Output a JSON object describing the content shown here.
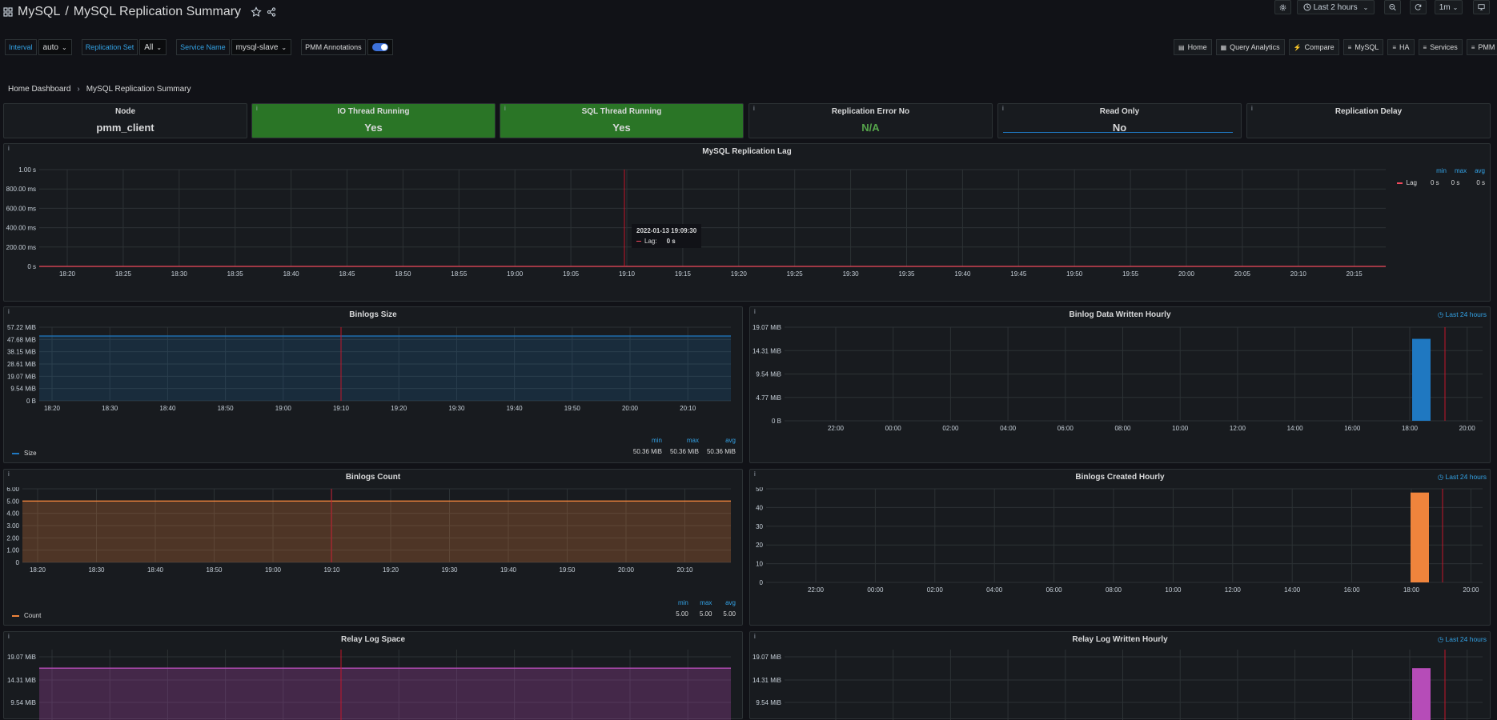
{
  "header": {
    "breadcrumb_folder": "MySQL",
    "breadcrumb_sep": "/",
    "dashboard_title": "MySQL Replication Summary",
    "time_range": "Last 2 hours",
    "refresh_interval": "1m"
  },
  "variables": {
    "interval_label": "Interval",
    "interval_value": "auto",
    "replication_set_label": "Replication Set",
    "replication_set_value": "All",
    "service_name_label": "Service Name",
    "service_name_value": "mysql-slave",
    "annotations_label": "PMM Annotations"
  },
  "links": [
    "Home",
    "Query Analytics",
    "Compare",
    "MySQL",
    "HA",
    "Services",
    "PMM"
  ],
  "breadcrumb": {
    "home": "Home Dashboard",
    "current": "MySQL Replication Summary"
  },
  "stats": [
    {
      "title": "Node",
      "value": "pmm_client"
    },
    {
      "title": "IO Thread Running",
      "value": "Yes"
    },
    {
      "title": "SQL Thread Running",
      "value": "Yes"
    },
    {
      "title": "Replication Error No",
      "value": "N/A"
    },
    {
      "title": "Read Only",
      "value": "No"
    },
    {
      "title": "Replication Delay",
      "value": ""
    }
  ],
  "colors": {
    "green_stat": "#2a7526",
    "lag": "#f2495c",
    "size": "#1f78c1",
    "count": "#ef843c",
    "relay": "#b64cb8",
    "link": "#33a2e5"
  },
  "legend_headers": {
    "min": "min",
    "max": "max",
    "avg": "avg"
  },
  "last24_label": "Last 24 hours",
  "tooltip": {
    "time": "2022-01-13 19:09:30",
    "series": "Lag:",
    "value": "0 s"
  },
  "panels": {
    "lag": {
      "title": "MySQL Replication Lag",
      "legend_name": "Lag",
      "min": "0 s",
      "max": "0 s",
      "avg": "0 s"
    },
    "binlogs_size": {
      "title": "Binlogs Size",
      "legend_name": "Size",
      "min": "50.36 MiB",
      "max": "50.36 MiB",
      "avg": "50.36 MiB"
    },
    "binlog_written": {
      "title": "Binlog Data Written Hourly"
    },
    "binlogs_count": {
      "title": "Binlogs Count",
      "legend_name": "Count",
      "min": "5.00",
      "max": "5.00",
      "avg": "5.00"
    },
    "binlogs_created": {
      "title": "Binlogs Created Hourly"
    },
    "relay_space": {
      "title": "Relay Log Space"
    },
    "relay_written": {
      "title": "Relay Log Written Hourly"
    }
  },
  "chart_data": [
    {
      "type": "line",
      "title": "MySQL Replication Lag",
      "series": [
        {
          "name": "Lag",
          "values": [
            0,
            0
          ]
        }
      ],
      "x": [
        "18:20",
        "20:15"
      ],
      "xticks": [
        "18:20",
        "18:25",
        "18:30",
        "18:35",
        "18:40",
        "18:45",
        "18:50",
        "18:55",
        "19:00",
        "19:05",
        "19:10",
        "19:15",
        "19:20",
        "19:25",
        "19:30",
        "19:35",
        "19:40",
        "19:45",
        "19:50",
        "19:55",
        "20:00",
        "20:05",
        "20:10",
        "20:15"
      ],
      "yticks": [
        "0 s",
        "200.00 ms",
        "400.00 ms",
        "600.00 ms",
        "800.00 ms",
        "1.00 s"
      ],
      "ylim": [
        0,
        1
      ]
    },
    {
      "type": "area",
      "title": "Binlogs Size",
      "series": [
        {
          "name": "Size",
          "values": [
            50.36,
            50.36
          ]
        }
      ],
      "xticks": [
        "18:20",
        "18:30",
        "18:40",
        "18:50",
        "19:00",
        "19:10",
        "19:20",
        "19:30",
        "19:40",
        "19:50",
        "20:00",
        "20:10"
      ],
      "yticks": [
        "0 B",
        "9.54 MiB",
        "19.07 MiB",
        "28.61 MiB",
        "38.15 MiB",
        "47.68 MiB",
        "57.22 MiB"
      ],
      "ylim": [
        0,
        57.22
      ]
    },
    {
      "type": "bar",
      "title": "Binlog Data Written Hourly",
      "xticks": [
        "22:00",
        "00:00",
        "02:00",
        "04:00",
        "06:00",
        "08:00",
        "10:00",
        "12:00",
        "14:00",
        "16:00",
        "18:00",
        "20:00"
      ],
      "yticks": [
        "0 B",
        "4.77 MiB",
        "9.54 MiB",
        "14.31 MiB",
        "19.07 MiB"
      ],
      "categories": [
        "18:00"
      ],
      "values": [
        16.7
      ],
      "ylim": [
        0,
        19.07
      ]
    },
    {
      "type": "area",
      "title": "Binlogs Count",
      "series": [
        {
          "name": "Count",
          "values": [
            5,
            5
          ]
        }
      ],
      "xticks": [
        "18:20",
        "18:30",
        "18:40",
        "18:50",
        "19:00",
        "19:10",
        "19:20",
        "19:30",
        "19:40",
        "19:50",
        "20:00",
        "20:10"
      ],
      "yticks": [
        "0",
        "1.00",
        "2.00",
        "3.00",
        "4.00",
        "5.00",
        "6.00"
      ],
      "ylim": [
        0,
        6
      ]
    },
    {
      "type": "bar",
      "title": "Binlogs Created Hourly",
      "xticks": [
        "22:00",
        "00:00",
        "02:00",
        "04:00",
        "06:00",
        "08:00",
        "10:00",
        "12:00",
        "14:00",
        "16:00",
        "18:00",
        "20:00"
      ],
      "yticks": [
        "0",
        "10",
        "20",
        "30",
        "40",
        "50"
      ],
      "categories": [
        "18:00"
      ],
      "values": [
        48
      ],
      "ylim": [
        0,
        50
      ]
    },
    {
      "type": "area",
      "title": "Relay Log Space",
      "series": [
        {
          "values": [
            16.7,
            16.7
          ]
        }
      ],
      "yticks": [
        "9.54 MiB",
        "14.31 MiB",
        "19.07 MiB"
      ],
      "ylim": [
        0,
        19.07
      ]
    },
    {
      "type": "bar",
      "title": "Relay Log Written Hourly",
      "yticks": [
        "9.54 MiB",
        "14.31 MiB",
        "19.07 MiB"
      ],
      "categories": [
        "18:00"
      ],
      "values": [
        16.7
      ],
      "ylim": [
        0,
        19.07
      ]
    }
  ]
}
